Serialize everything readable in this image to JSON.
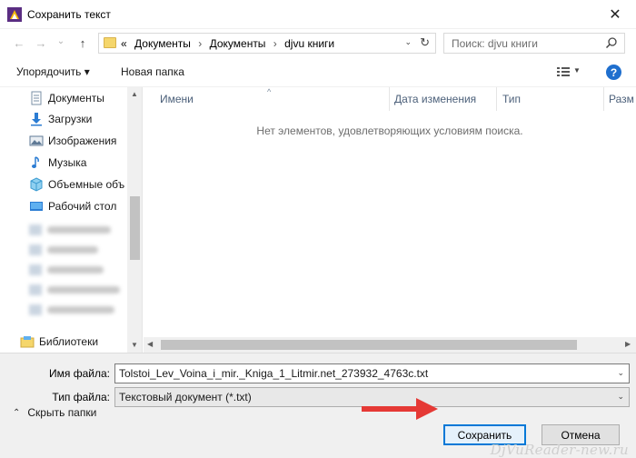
{
  "window": {
    "title": "Сохранить текст",
    "close_glyph": "✕"
  },
  "nav": {
    "back_glyph": "←",
    "forward_glyph": "→",
    "dropdown_glyph": "⌄",
    "up_glyph": "↑",
    "breadcrumb_prefix": "«",
    "breadcrumbs": [
      "Документы",
      "Документы",
      "djvu книги"
    ],
    "crumb_separator": "›",
    "refresh_glyph": "↻",
    "search_placeholder": "Поиск: djvu книги"
  },
  "toolbar": {
    "organize_label": "Упорядочить ▾",
    "new_folder_label": "Новая папка",
    "help_glyph": "?"
  },
  "sidebar": {
    "items": [
      {
        "label": "Документы",
        "icon": "documents-icon"
      },
      {
        "label": "Загрузки",
        "icon": "downloads-icon"
      },
      {
        "label": "Изображения",
        "icon": "pictures-icon"
      },
      {
        "label": "Музыка",
        "icon": "music-icon"
      },
      {
        "label": "Объемные объ",
        "icon": "3d-objects-icon"
      },
      {
        "label": "Рабочий стол",
        "icon": "desktop-icon"
      }
    ],
    "libraries_label": "Библиотеки",
    "scroll_up_glyph": "▲",
    "scroll_down_glyph": "▼"
  },
  "filelist": {
    "columns": [
      "Имени",
      "Дата изменения",
      "Тип",
      "Разм"
    ],
    "sort_glyph": "^",
    "empty_message": "Нет элементов, удовлетворяющих условиям поиска.",
    "scroll_left_glyph": "◀",
    "scroll_right_glyph": "▶"
  },
  "form": {
    "filename_label": "Имя файла:",
    "filename_value": "Tolstoi_Lev_Voina_i_mir._Kniga_1_Litmir.net_273932_4763c.txt",
    "filetype_label": "Тип файла:",
    "filetype_value": "Текстовый документ (*.txt)",
    "combo_arrow_glyph": "⌄",
    "hide_folders_label": "Скрыть папки",
    "hide_folders_glyph": "⌃",
    "save_label": "Сохранить",
    "cancel_label": "Отмена"
  },
  "watermark": "DjVuReader-new.ru",
  "colors": {
    "accent": "#0078d7",
    "arrow": "#e53935"
  }
}
